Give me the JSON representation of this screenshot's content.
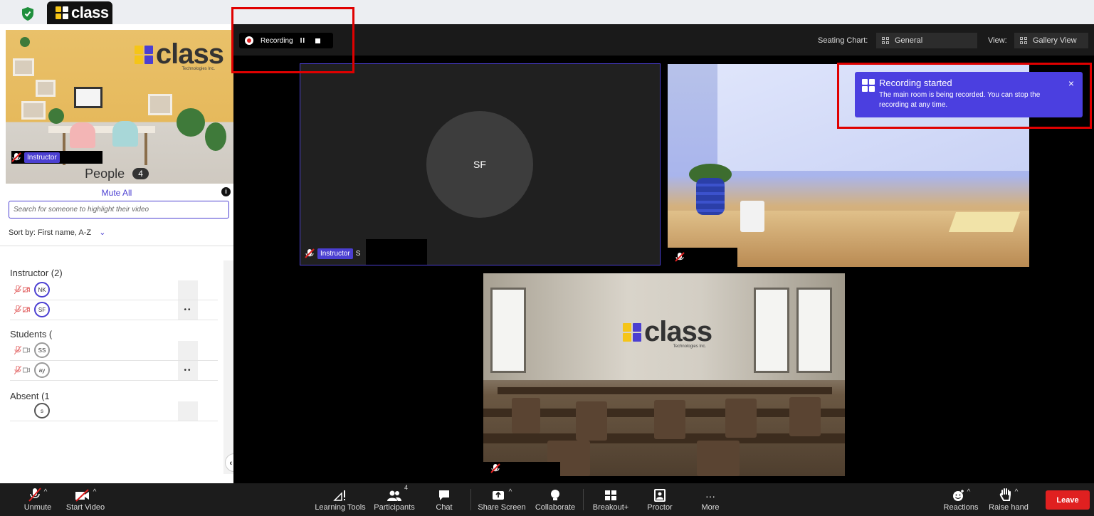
{
  "browser": {
    "tab_label": "class"
  },
  "sidebar": {
    "instructor_video": {
      "logo_text": "class",
      "logo_sub": "Technologies Inc.",
      "tag": "Instructor"
    },
    "people_title": "People",
    "people_count": "4",
    "mute_all": "Mute All",
    "search_placeholder": "Search for someone to highlight their video",
    "sort_label": "Sort by: First name, A-Z",
    "groups": {
      "instructor": "Instructor (2)",
      "students": "Students (",
      "absent": "Absent (1"
    },
    "participants": [
      {
        "initials": "NK"
      },
      {
        "initials": "SF"
      },
      {
        "initials": "SS"
      },
      {
        "initials": "ay"
      },
      {
        "initials": "s"
      }
    ],
    "row_options": "••"
  },
  "main": {
    "recording": {
      "label": "Recording",
      "pause": "II"
    },
    "seating_chart_label": "Seating Chart:",
    "seating_chart_value": "General",
    "view_label": "View:",
    "view_value": "Gallery View",
    "tiles": {
      "sf_initials": "SF",
      "sf_tag": "Instructor",
      "sf_name": "S",
      "class_logo": "class",
      "class_logo_sub": "Technologies Inc."
    },
    "toast": {
      "title": "Recording started",
      "body": "The main room is being recorded. You can stop the recording at any time.",
      "close": "×"
    }
  },
  "toolbar": {
    "unmute": "Unmute",
    "start_video": "Start Video",
    "learning_tools": "Learning Tools",
    "participants": "Participants",
    "participants_count": "4",
    "chat": "Chat",
    "share_screen": "Share Screen",
    "collaborate": "Collaborate",
    "breakout": "Breakout+",
    "proctor": "Proctor",
    "more": "More",
    "more_glyph": "···",
    "reactions": "Reactions",
    "raise_hand": "Raise hand",
    "leave": "Leave"
  },
  "colors": {
    "accent": "#4b3fd1",
    "toast": "#4b3fe0",
    "leave": "#e02020",
    "highlight_box": "#e00000"
  }
}
